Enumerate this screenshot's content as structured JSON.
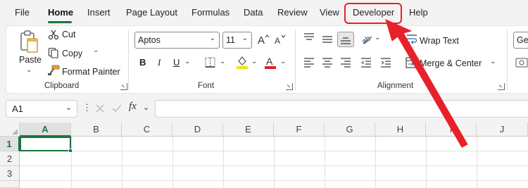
{
  "menu": {
    "tabs": [
      {
        "label": "File"
      },
      {
        "label": "Home"
      },
      {
        "label": "Insert"
      },
      {
        "label": "Page Layout"
      },
      {
        "label": "Formulas"
      },
      {
        "label": "Data"
      },
      {
        "label": "Review"
      },
      {
        "label": "View"
      },
      {
        "label": "Developer"
      },
      {
        "label": "Help"
      }
    ],
    "active_tab": "Home",
    "highlighted_tab": "Developer"
  },
  "ribbon": {
    "clipboard": {
      "group_label": "Clipboard",
      "paste_label": "Paste",
      "cut_label": "Cut",
      "copy_label": "Copy",
      "format_painter_label": "Format Painter"
    },
    "font": {
      "group_label": "Font",
      "font_name": "Aptos",
      "font_size": "11",
      "bold": "B",
      "italic": "I",
      "underline": "U",
      "highlight_color": "#f5e50a",
      "font_color": "#e02020"
    },
    "alignment": {
      "group_label": "Alignment",
      "wrap_text_label": "Wrap Text",
      "merge_center_label": "Merge & Center"
    },
    "number": {
      "format_partial": "Ger"
    }
  },
  "formula_bar": {
    "name_box": "A1",
    "fx_label": "fx",
    "value": ""
  },
  "sheet": {
    "columns": [
      "A",
      "B",
      "C",
      "D",
      "E",
      "F",
      "G",
      "H",
      "I",
      "J"
    ],
    "rows": [
      "1",
      "2",
      "3"
    ],
    "selected_cell": "A1"
  },
  "colors": {
    "accent": "#1a7343",
    "annotation": "#e8202a"
  }
}
